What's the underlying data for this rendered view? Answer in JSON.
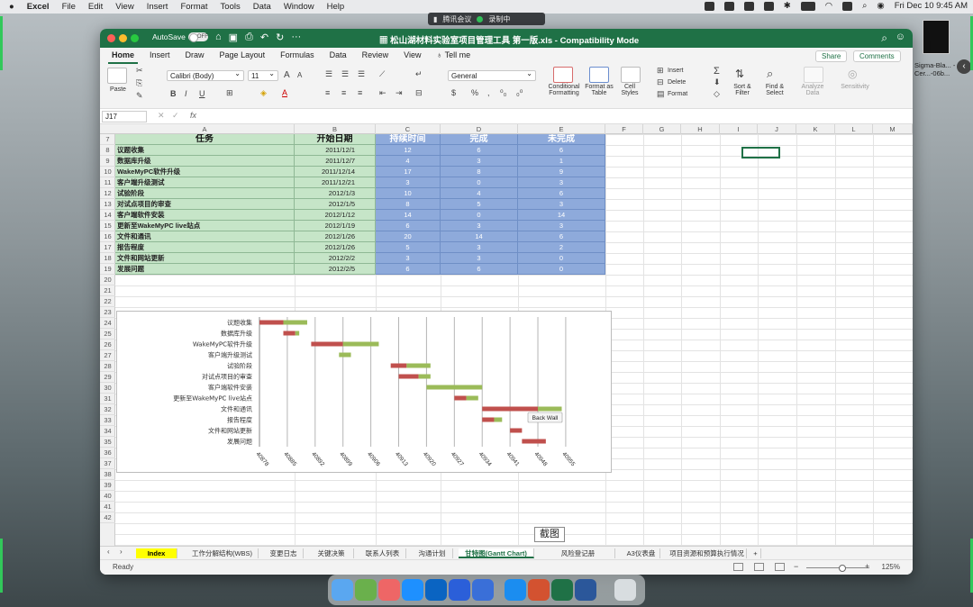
{
  "menubar": {
    "app": "Excel",
    "items": [
      "File",
      "Edit",
      "View",
      "Insert",
      "Format",
      "Tools",
      "Data",
      "Window",
      "Help"
    ],
    "datetime": "Fri Dec 10  9:45 AM"
  },
  "meeting": {
    "app": "腾讯会议",
    "recording": "录制中"
  },
  "window": {
    "autosave": "AutoSave",
    "autosave_state": "OFF",
    "title": "松山湖材料实验室项目管理工具 第一版.xls  -  Compatibility Mode"
  },
  "ribbon_tabs": [
    "Home",
    "Insert",
    "Draw",
    "Page Layout",
    "Formulas",
    "Data",
    "Review",
    "View",
    "Tell me"
  ],
  "share": "Share",
  "comments": "Comments",
  "ribbon": {
    "paste": "Paste",
    "font": "Calibri (Body)",
    "size": "11",
    "number_format": "General",
    "cond_format": "Conditional Formatting",
    "format_table": "Format as Table",
    "cell_styles": "Cell Styles",
    "insert": "Insert",
    "delete": "Delete",
    "format": "Format",
    "sort_filter": "Sort & Filter",
    "find_select": "Find & Select",
    "analyze": "Analyze Data",
    "sensitivity": "Sensitivity"
  },
  "namebox": "J17",
  "fx": "fx",
  "columns": [
    "A",
    "B",
    "C",
    "D",
    "E",
    "F",
    "G",
    "H",
    "I",
    "J",
    "K",
    "L",
    "M"
  ],
  "rows": [
    "7",
    "8",
    "9",
    "10",
    "11",
    "12",
    "13",
    "14",
    "15",
    "16",
    "17",
    "18",
    "19",
    "20",
    "21",
    "22",
    "23",
    "24",
    "25",
    "26",
    "27",
    "28",
    "29",
    "30",
    "31",
    "32",
    "33",
    "34",
    "35",
    "36",
    "37",
    "38",
    "39",
    "40",
    "41",
    "42"
  ],
  "table": {
    "headers": [
      "任务",
      "开始日期",
      "持续时间",
      "完成",
      "未完成"
    ],
    "rows": [
      {
        "task": "议题收集",
        "start": "2011/12/1",
        "dur": "12",
        "done": "6",
        "todo": "6"
      },
      {
        "task": "数据库升级",
        "start": "2011/12/7",
        "dur": "4",
        "done": "3",
        "todo": "1"
      },
      {
        "task": "WakeMyPC软件升级",
        "start": "2011/12/14",
        "dur": "17",
        "done": "8",
        "todo": "9"
      },
      {
        "task": "客户端升级测试",
        "start": "2011/12/21",
        "dur": "3",
        "done": "0",
        "todo": "3"
      },
      {
        "task": "试验阶段",
        "start": "2012/1/3",
        "dur": "10",
        "done": "4",
        "todo": "6"
      },
      {
        "task": "对试点项目的审查",
        "start": "2012/1/5",
        "dur": "8",
        "done": "5",
        "todo": "3"
      },
      {
        "task": "客户端软件安装",
        "start": "2012/1/12",
        "dur": "14",
        "done": "0",
        "todo": "14"
      },
      {
        "task": "更新至WakeMyPC live站点",
        "start": "2012/1/19",
        "dur": "6",
        "done": "3",
        "todo": "3"
      },
      {
        "task": "文件和通讯",
        "start": "2012/1/26",
        "dur": "20",
        "done": "14",
        "todo": "6"
      },
      {
        "task": "报告程度",
        "start": "2012/1/26",
        "dur": "5",
        "done": "3",
        "todo": "2"
      },
      {
        "task": "文件和网站更新",
        "start": "2012/2/2",
        "dur": "3",
        "done": "3",
        "todo": "0"
      },
      {
        "task": "发展问题",
        "start": "2012/2/5",
        "dur": "6",
        "done": "6",
        "todo": "0"
      }
    ]
  },
  "chart_data": {
    "type": "bar",
    "orientation": "horizontal-stacked",
    "categories": [
      "议题收集",
      "数据库升级",
      "WakeMyPC软件升级",
      "客户端升级测试",
      "试验阶段",
      "对试点项目的审查",
      "客户端软件安装",
      "更新至WakeMyPC live站点",
      "文件和通讯",
      "报告程度",
      "文件和网站更新",
      "发展问题"
    ],
    "start": [
      40878,
      40884,
      40891,
      40898,
      40911,
      40913,
      40920,
      40927,
      40934,
      40934,
      40941,
      40944
    ],
    "series": [
      {
        "values": [
          6,
          3,
          8,
          0,
          4,
          5,
          0,
          3,
          14,
          3,
          3,
          6
        ],
        "color": "#c0504d"
      },
      {
        "values": [
          6,
          1,
          9,
          3,
          6,
          3,
          14,
          3,
          6,
          2,
          0,
          0
        ],
        "color": "#9bbb59"
      }
    ],
    "x_ticks": [
      "40878",
      "40885",
      "40892",
      "40899",
      "40906",
      "40913",
      "40920",
      "40927",
      "40934",
      "40941",
      "40948",
      "40955"
    ],
    "xlim": [
      40878,
      40960
    ],
    "grid": true,
    "tooltip": "Back Wall"
  },
  "sheet_tabs": [
    "Index",
    "工作分解结构(WBS)",
    "变更日志",
    "关键决策",
    "联系人列表",
    "沟通计划",
    "甘特图(Gantt Chart)",
    "风险登记册",
    "A3仪表盘",
    "项目资源和预算执行情况",
    "+"
  ],
  "status": "Ready",
  "zoom": "125%",
  "snip_label": "截图",
  "side_label": "Sigma-Bla... -Cer...-06b..."
}
